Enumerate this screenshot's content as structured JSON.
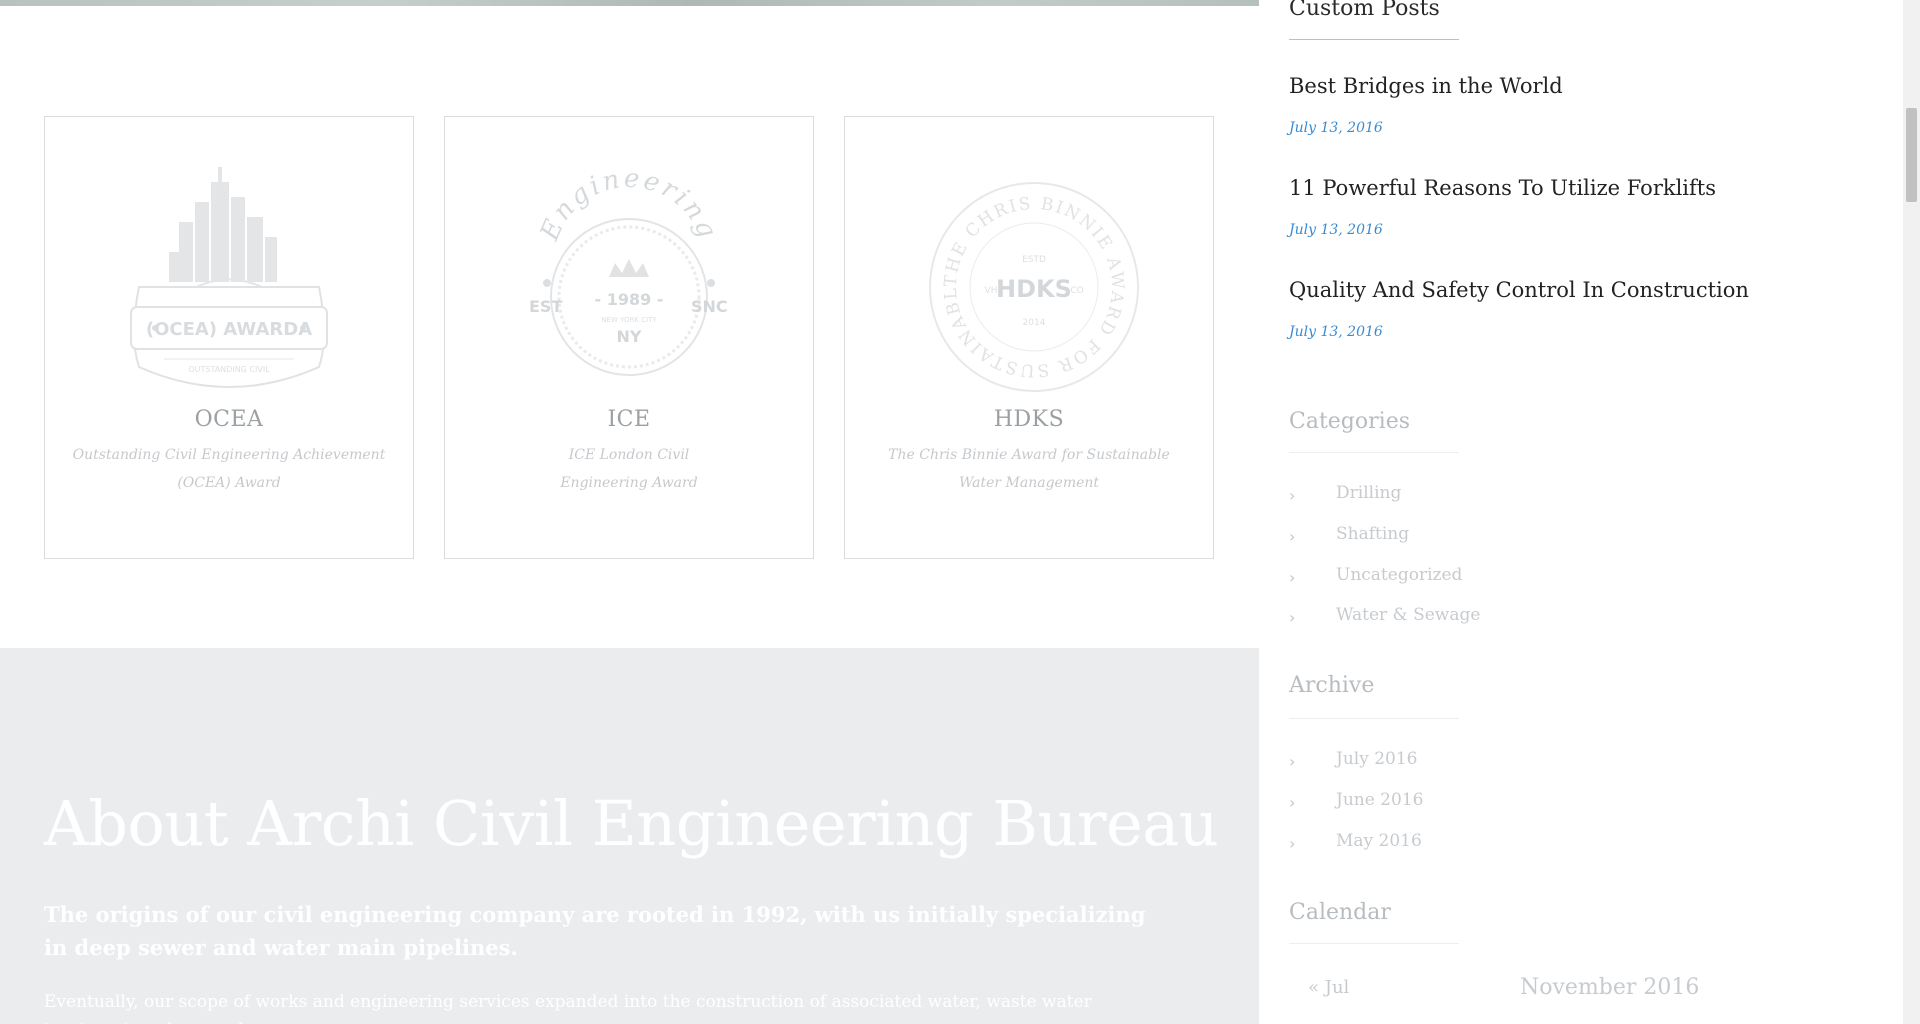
{
  "colors": {
    "accent_date": "#3a8bd0",
    "about_background": "#ebecee",
    "faded_text": "#c7cbcf"
  },
  "awards": [
    {
      "logo_text": "(OCEA) AWARDA",
      "logo_subtext": "OUTSTANDING CIVIL",
      "title": "OCEA",
      "desc": "Outstanding Civil Engineering Achievement (OCEA) Award"
    },
    {
      "logo_arc": "Engineering",
      "logo_year": "- 1989 -",
      "logo_city": "NEW YORK CITY",
      "logo_ny": "NY",
      "logo_left": "EST",
      "logo_right": "SNC",
      "title": "ICE",
      "desc": "ICE London Civil Engineering Award"
    },
    {
      "logo_ring": "THE CHRIS BINNIE AWARD FOR SUSTAINABLE",
      "logo_top": "ESTD",
      "logo_center": "HDKS",
      "logo_left": "VH",
      "logo_right": "CO",
      "logo_year": "2014",
      "title": "HDKS",
      "desc": "The Chris Binnie Award for Sustainable Water Management"
    }
  ],
  "about": {
    "title": "About Archi Civil Engineering Bureau",
    "lead": "The origins of our civil engineering company are rooted in 1992, with us initially specializing in deep sewer and water main pipelines.",
    "body": "Eventually, our scope of works and engineering services expanded into the construction of associated water, waste water treatment, and general"
  },
  "sidebar": {
    "custom_posts_title": "Custom Posts",
    "posts": [
      {
        "title": "Best Bridges in the World",
        "date": "July 13, 2016"
      },
      {
        "title": "11 Powerful Reasons To Utilize Forklifts",
        "date": "July 13, 2016"
      },
      {
        "title": "Quality And Safety Control In Construction",
        "date": "July 13, 2016"
      }
    ],
    "categories_title": "Categories",
    "categories": [
      "Drilling",
      "Shafting",
      "Uncategorized",
      "Water & Sewage"
    ],
    "archive_title": "Archive",
    "archive": [
      "July 2016",
      "June 2016",
      "May 2016"
    ],
    "calendar_title": "Calendar",
    "calendar_prev": "« Jul",
    "calendar_month": "November 2016"
  }
}
